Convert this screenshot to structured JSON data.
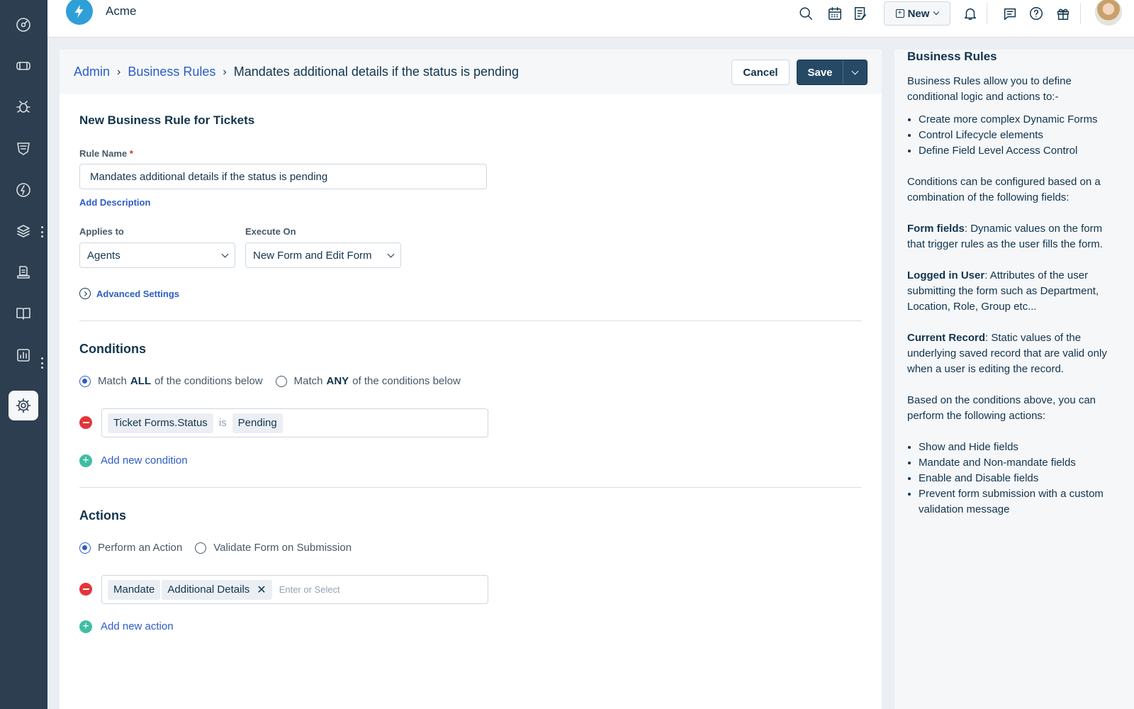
{
  "app": {
    "brand": "Acme",
    "new_label": "New"
  },
  "sidebar": {
    "items": [
      {
        "name": "dashboard-icon"
      },
      {
        "name": "tickets-icon"
      },
      {
        "name": "problems-icon"
      },
      {
        "name": "changes-icon"
      },
      {
        "name": "releases-icon"
      },
      {
        "name": "assets-icon"
      },
      {
        "name": "contracts-icon"
      },
      {
        "name": "solutions-icon"
      },
      {
        "name": "analytics-icon"
      },
      {
        "name": "admin-gear-icon",
        "active": true
      }
    ]
  },
  "breadcrumb": {
    "admin": "Admin",
    "business_rules": "Business Rules",
    "current": "Mandates additional details if the status is pending"
  },
  "toolbar": {
    "cancel_label": "Cancel",
    "save_label": "Save"
  },
  "form": {
    "title": "New Business Rule for Tickets",
    "rule_name_label": "Rule Name",
    "required_mark": "*",
    "rule_name_value": "Mandates additional details if the status is pending",
    "add_description": "Add Description",
    "applies_to_label": "Applies to",
    "applies_to_value": "Agents",
    "execute_on_label": "Execute On",
    "execute_on_value": "New Form and Edit Form",
    "advanced_settings": "Advanced Settings"
  },
  "conditions": {
    "heading": "Conditions",
    "match_all_prefix": "Match",
    "match_all_keyword": "ALL",
    "match_all_suffix": "of the conditions below",
    "match_any_prefix": "Match",
    "match_any_keyword": "ANY",
    "match_any_suffix": "of the conditions below",
    "selected": "all",
    "rule": {
      "field": "Ticket Forms.Status",
      "operator": "is",
      "value": "Pending"
    },
    "add_label": "Add new condition"
  },
  "actions": {
    "heading": "Actions",
    "perform_label": "Perform an Action",
    "validate_label": "Validate Form on Submission",
    "selected": "perform",
    "rule": {
      "action": "Mandate",
      "field": "Additional Details",
      "placeholder": "Enter or Select"
    },
    "add_label": "Add new action"
  },
  "help": {
    "title": "Business Rules",
    "intro": "Business Rules allow you to define conditional logic and actions to:-",
    "uses": [
      "Create more complex Dynamic Forms",
      "Control Lifecycle elements",
      "Define Field Level Access Control"
    ],
    "conditions_intro": "Conditions can be configured based on a combination of the following fields:",
    "form_fields_term": "Form fields",
    "form_fields_desc": ": Dynamic values on the form that trigger rules as the user fills the form.",
    "logged_in_term": "Logged in User",
    "logged_in_desc": ": Attributes of the user submitting the form such as Department, Location, Role, Group etc...",
    "current_record_term": "Current Record",
    "current_record_desc": ": Static values of the underlying saved record that are valid only when a user is editing the record.",
    "actions_intro": "Based on the conditions above, you can perform the following actions:",
    "actions": [
      "Show and Hide fields",
      "Mandate and Non-mandate fields",
      "Enable and Disable fields",
      "Prevent form submission with a custom validation message"
    ]
  },
  "colors": {
    "sidebar": "#2c3e50",
    "link": "#2c5cc5",
    "primary_button": "#264966",
    "danger": "#e43538"
  }
}
